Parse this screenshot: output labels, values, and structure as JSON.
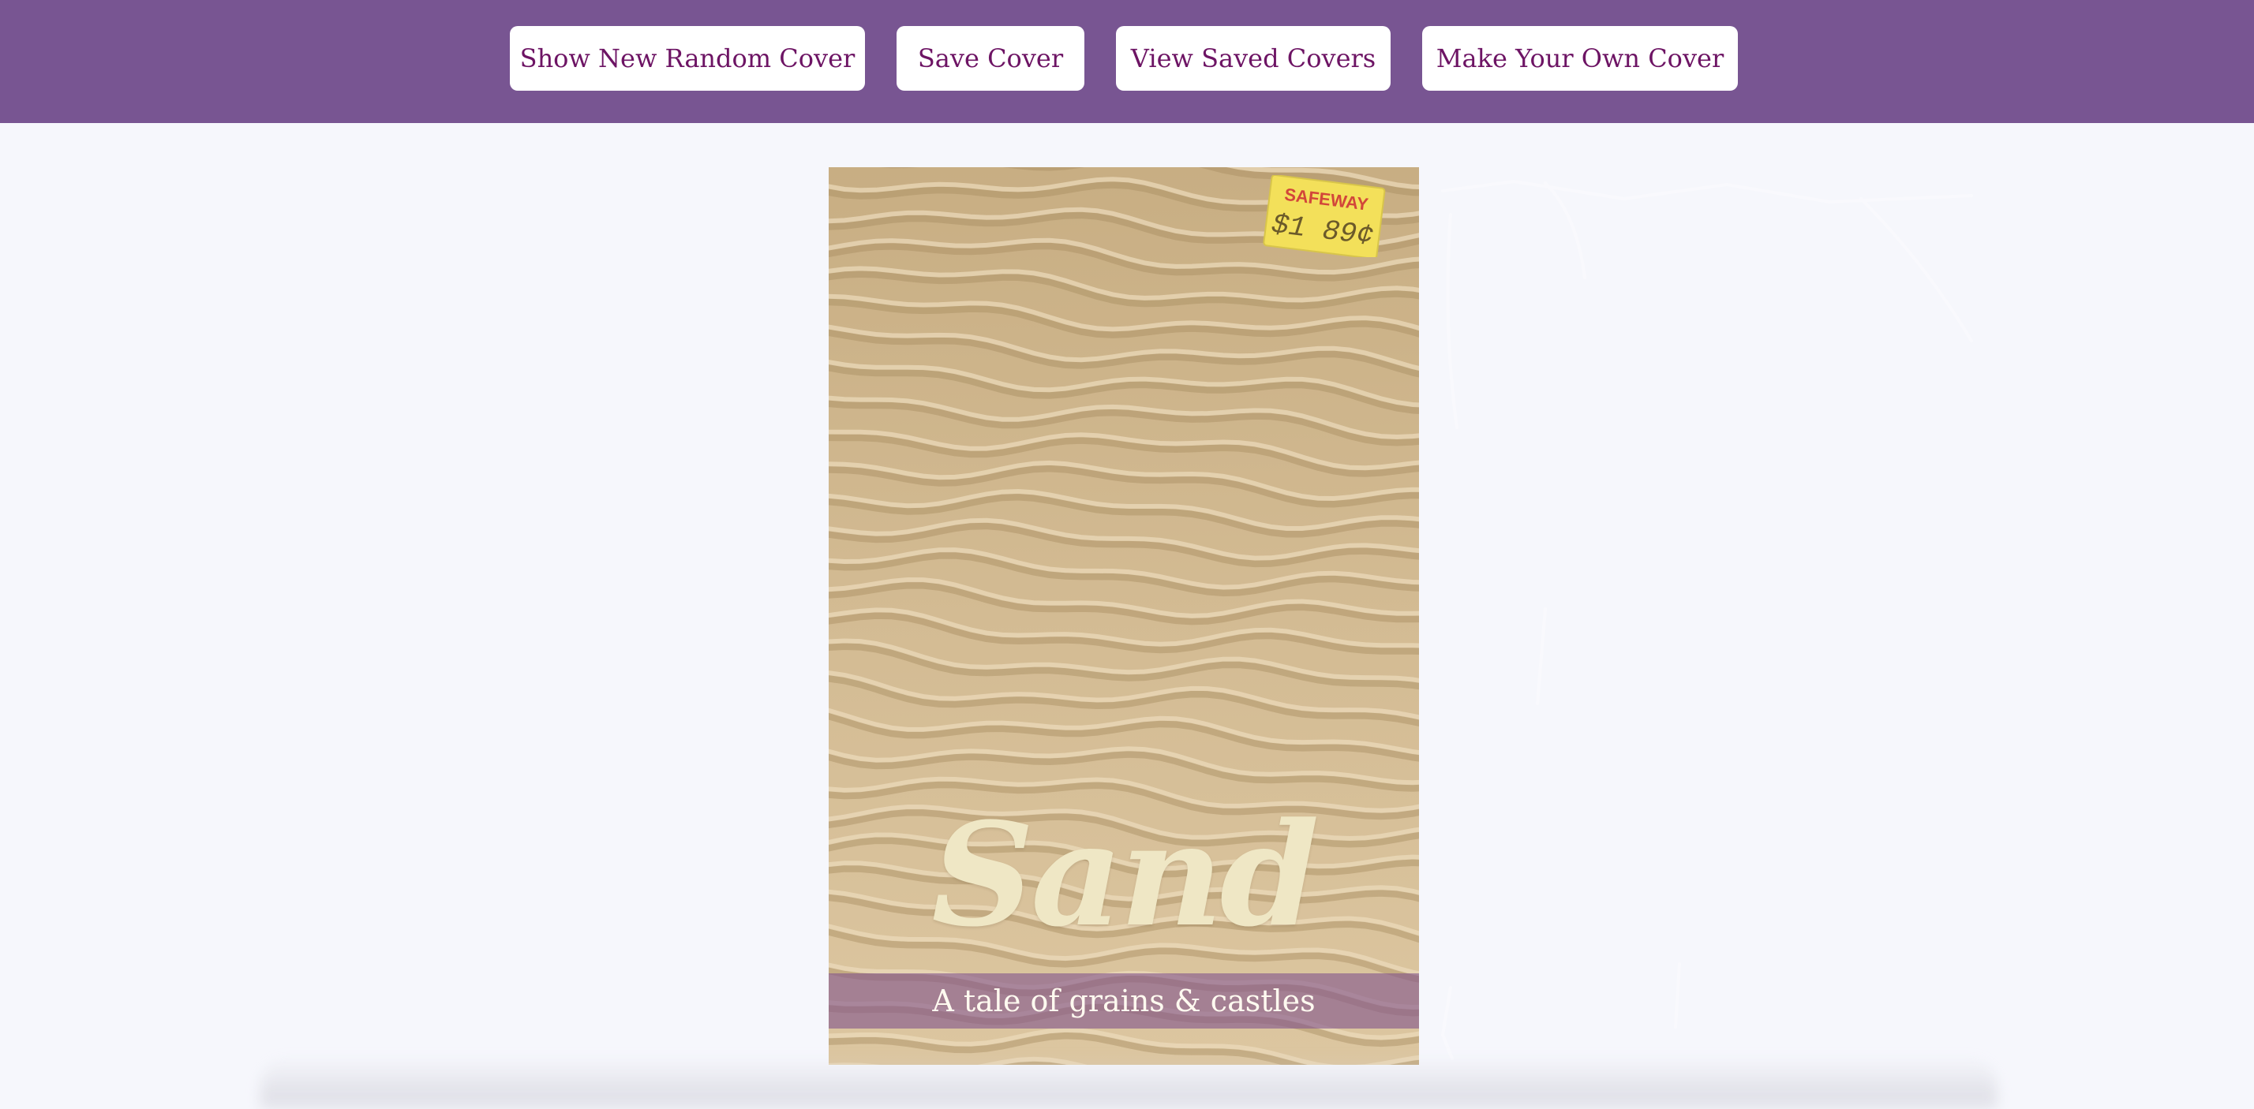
{
  "toolbar": {
    "show_random_label": "Show New Random Cover",
    "save_label": "Save Cover",
    "view_saved_label": "View Saved Covers",
    "make_own_label": "Make Your Own Cover"
  },
  "cover": {
    "title": "Sand",
    "tagline": "A tale of grains & castles",
    "price_tag": {
      "store": "SAFEWAY",
      "price": "$1 89¢"
    }
  },
  "colors": {
    "toolbar_bg": "#785592",
    "button_text": "#6d1464",
    "page_bg": "#f6f7fc",
    "title_color": "#efe7c5",
    "tagline_band": "#82558c"
  }
}
